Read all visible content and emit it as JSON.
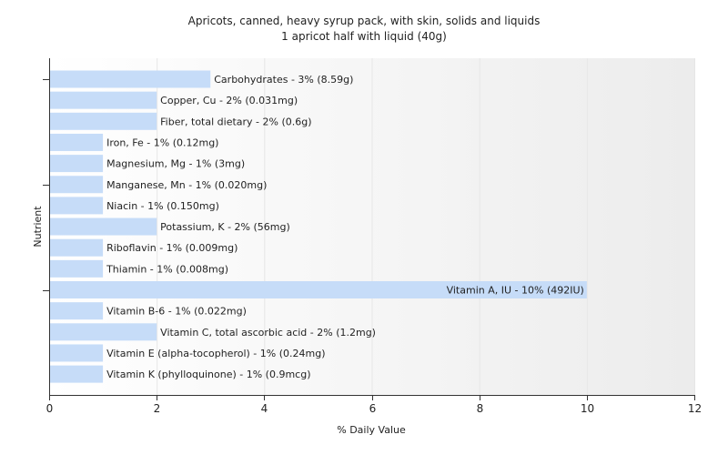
{
  "chart_data": {
    "type": "bar",
    "orientation": "horizontal",
    "title": "Apricots, canned, heavy syrup pack, with skin, solids and liquids",
    "subtitle": "1 apricot half with liquid (40g)",
    "xlabel": "% Daily Value",
    "ylabel": "Nutrient",
    "xlim": [
      0,
      12
    ],
    "xticks": [
      0,
      2,
      4,
      6,
      8,
      10,
      12
    ],
    "grid": true,
    "bar_color": "#c6dcf8",
    "categories": [
      "Carbohydrates",
      "Copper, Cu",
      "Fiber, total dietary",
      "Iron, Fe",
      "Magnesium, Mg",
      "Manganese, Mn",
      "Niacin",
      "Potassium, K",
      "Riboflavin",
      "Thiamin",
      "Vitamin A, IU",
      "Vitamin B-6",
      "Vitamin C, total ascorbic acid",
      "Vitamin E (alpha-tocopherol)",
      "Vitamin K (phylloquinone)"
    ],
    "values": [
      3,
      2,
      2,
      1,
      1,
      1,
      1,
      2,
      1,
      1,
      10,
      1,
      2,
      1,
      1
    ],
    "labels": [
      "Carbohydrates - 3% (8.59g)",
      "Copper, Cu - 2% (0.031mg)",
      "Fiber, total dietary - 2% (0.6g)",
      "Iron, Fe - 1% (0.12mg)",
      "Magnesium, Mg - 1% (3mg)",
      "Manganese, Mn - 1% (0.020mg)",
      "Niacin - 1% (0.150mg)",
      "Potassium, K - 2% (56mg)",
      "Riboflavin - 1% (0.009mg)",
      "Thiamin - 1% (0.008mg)",
      "Vitamin A, IU - 10% (492IU)",
      "Vitamin B-6 - 1% (0.022mg)",
      "Vitamin C, total ascorbic acid - 2% (1.2mg)",
      "Vitamin E (alpha-tocopherol) - 1% (0.24mg)",
      "Vitamin K (phylloquinone) - 1% (0.9mcg)"
    ]
  }
}
